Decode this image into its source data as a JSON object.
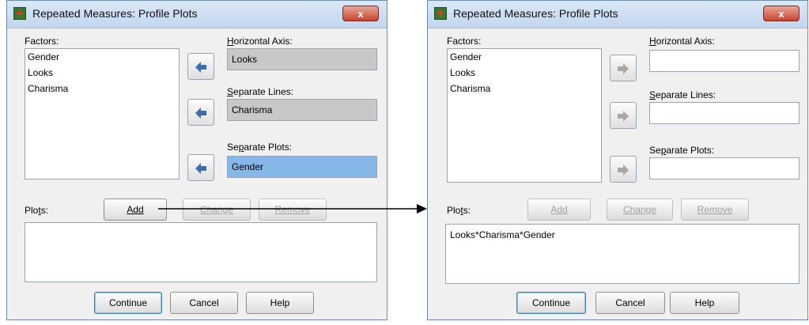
{
  "left_dialog": {
    "title": "Repeated Measures: Profile Plots",
    "close_label": "x",
    "factors_label": "Factors:",
    "factors": [
      "Gender",
      "Looks",
      "Charisma"
    ],
    "horizontal_axis_label": "Horizontal Axis:",
    "horizontal_axis_value": "Looks",
    "separate_lines_label": "Separate Lines:",
    "separate_lines_value": "Charisma",
    "separate_plots_label": "Separate Plots:",
    "separate_plots_value": "Gender",
    "plots_label": "Plots:",
    "add_label": "Add",
    "change_label": "Change",
    "remove_label": "Remove",
    "plots_items": [],
    "continue_label": "Continue",
    "cancel_label": "Cancel",
    "help_label": "Help"
  },
  "right_dialog": {
    "title": "Repeated Measures: Profile Plots",
    "close_label": "x",
    "factors_label": "Factors:",
    "factors": [
      "Gender",
      "Looks",
      "Charisma"
    ],
    "horizontal_axis_label": "Horizontal Axis:",
    "horizontal_axis_value": "",
    "separate_lines_label": "Separate Lines:",
    "separate_lines_value": "",
    "separate_plots_label": "Separate Plots:",
    "separate_plots_value": "",
    "plots_label": "Plots:",
    "add_label": "Add",
    "change_label": "Change",
    "remove_label": "Remove",
    "plots_items": [
      "Looks*Charisma*Gender"
    ],
    "continue_label": "Continue",
    "cancel_label": "Cancel",
    "help_label": "Help"
  },
  "colors": {
    "dialog_bg": "#f0f0f0",
    "title_bar": "#c2d6ee",
    "close_button": "#c74530",
    "selected_field": "#85b8e8",
    "arrow_active": "#3d6fb0",
    "arrow_disabled": "#a8a8a8"
  },
  "icons": {
    "app_icon": "spss-app-icon",
    "move_arrow_active": "arrow-left-icon",
    "move_arrow_disabled": "arrow-right-icon"
  }
}
